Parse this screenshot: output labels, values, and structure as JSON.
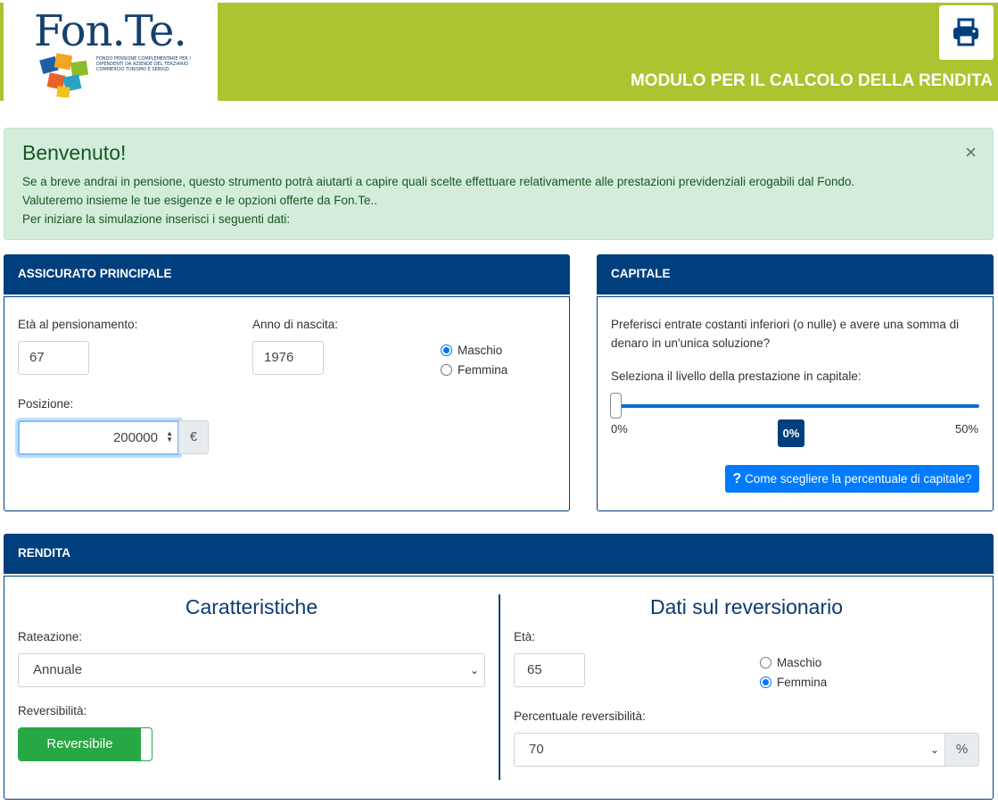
{
  "header": {
    "logo_text": "Fon.Te.",
    "logo_subtitle": "FONDO PENSIONE COMPLEMENTARE PER I DIPENDENTI DA AZIENDE DEL TERZIARIO COMMERCIO TURISMO E SERVIZI",
    "title": "MODULO PER IL CALCOLO DELLA RENDITA",
    "print_icon": "print-icon",
    "brand_color": "#adc32f"
  },
  "alert": {
    "title": "Benvenuto!",
    "close": "×",
    "lines": [
      "Se a breve andrai in pensione, questo strumento potrà aiutarti a capire quali scelte effettuare relativamente alle prestazioni previdenziali erogabili dal Fondo.",
      "Valuteremo insieme le tue esigenze e le opzioni offerte da Fon.Te..",
      "Per iniziare la simulazione inserisci i seguenti dati:"
    ]
  },
  "assicurato": {
    "title": "ASSICURATO PRINCIPALE",
    "eta_label": "Età al pensionamento:",
    "eta_value": "67",
    "anno_label": "Anno di nascita:",
    "anno_value": "1976",
    "sex_options": [
      "Maschio",
      "Femmina"
    ],
    "sex_selected": "Maschio",
    "posizione_label": "Posizione:",
    "posizione_value": "200000",
    "currency": "€"
  },
  "capitale": {
    "title": "CAPITALE",
    "question_1": "Preferisci entrate costanti inferiori (o nulle) e avere una somma di",
    "question_2": "denaro in un'unica soluzione?",
    "slider_label": "Seleziona il livello della prestazione in capitale:",
    "slider_min": "0%",
    "slider_max": "50%",
    "slider_value": "0%",
    "help_button": "Come scegliere la percentuale di capitale?",
    "help_icon": "question-icon"
  },
  "rendita": {
    "title": "RENDITA",
    "caratteristiche": {
      "heading": "Caratteristiche",
      "rateazione_label": "Rateazione:",
      "rateazione_value": "Annuale",
      "reversibilita_label": "Reversibilità:",
      "reversibilita_toggle": "Reversibile"
    },
    "reversionario": {
      "heading": "Dati sul reversionario",
      "eta_label": "Età:",
      "eta_value": "65",
      "sex_options": [
        "Maschio",
        "Femmina"
      ],
      "sex_selected": "Femmina",
      "percentuale_label": "Percentuale reversibilità:",
      "percentuale_value": "70",
      "percent_sign": "%"
    }
  }
}
